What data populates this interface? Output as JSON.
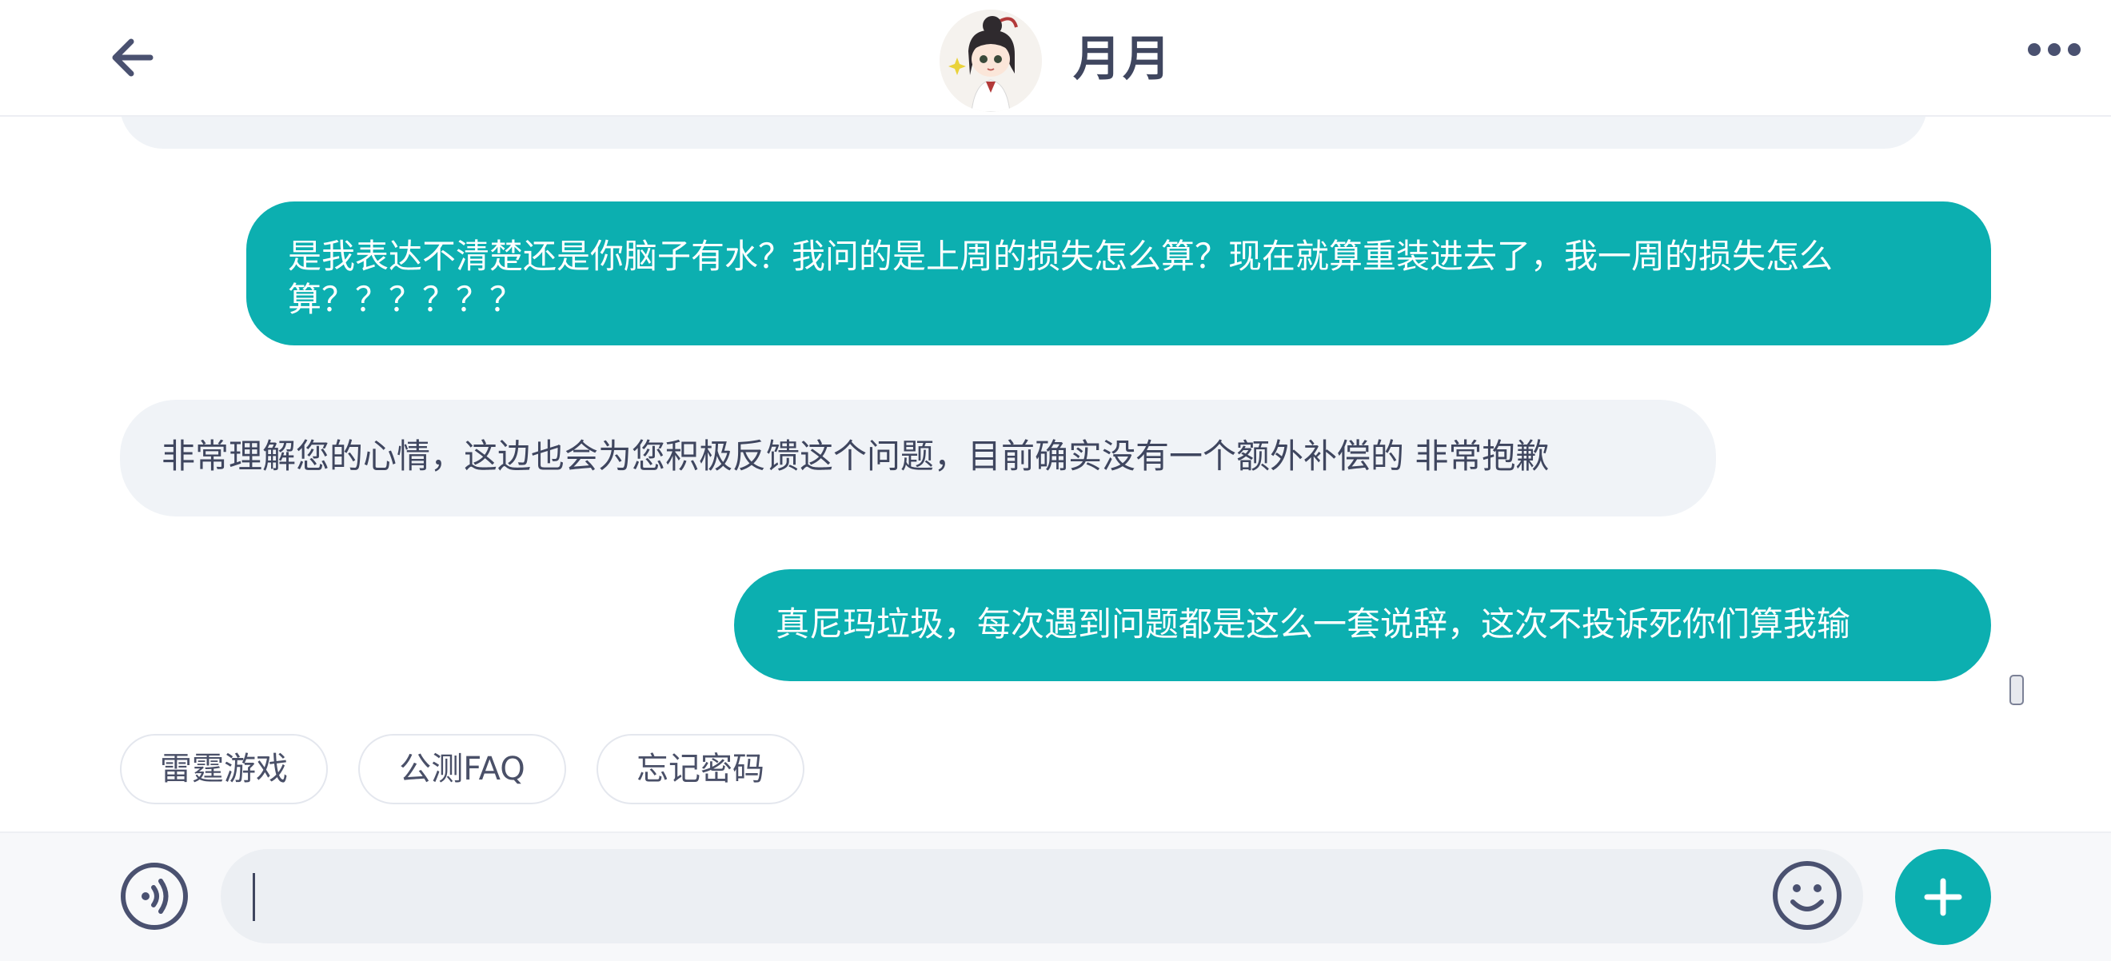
{
  "header": {
    "title": "月月",
    "back_icon": "arrow-left-icon",
    "more_icon": "more-horizontal-icon",
    "avatar": "anime-girl-avatar"
  },
  "messages": [
    {
      "from": "user",
      "text": "是我表达不清楚还是你脑子有水？我问的是上周的损失怎么算？现在就算重装进去了，我一周的损失怎么算？？？？？？"
    },
    {
      "from": "agent",
      "text": "非常理解您的心情，这边也会为您积极反馈这个问题，目前确实没有一个额外补偿的 非常抱歉"
    },
    {
      "from": "user",
      "text": "真尼玛垃圾，每次遇到问题都是这么一套说辞，这次不投诉死你们算我输"
    }
  ],
  "quick_replies": [
    "雷霆游戏",
    "公测FAQ",
    "忘记密码"
  ],
  "input": {
    "value": "",
    "voice_icon": "voice-icon",
    "emoji_icon": "emoji-icon",
    "add_icon": "plus-icon"
  },
  "colors": {
    "accent": "#0cafb0",
    "incoming_bubble": "#f0f3f7",
    "text": "#3f465f"
  }
}
